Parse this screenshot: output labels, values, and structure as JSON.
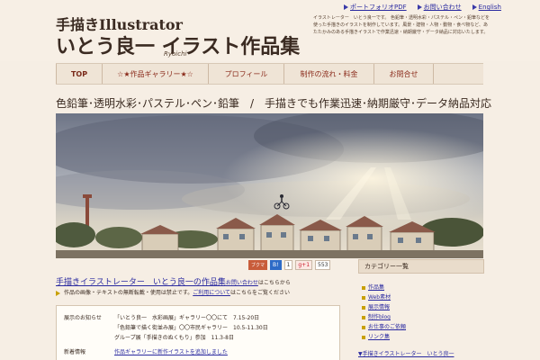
{
  "header": {
    "logo_line1": "手描きIllustrator",
    "logo_line2": "いとう良一 イラスト作品集",
    "logo_sub": "Ryoichi",
    "description": "イラストレーター　いとう良一です。 色鉛筆・透明水彩・パステル・ペン・鉛筆などを使った手描きのイラストを制作しています。風景・建物・人物・動物・食べ物など、あたたかみのある手描きイラストで作業迅速・納期厳守・データ納品に対応いたします。",
    "links": [
      {
        "label": "ポートフォリオPDF"
      },
      {
        "label": "お問い合わせ"
      },
      {
        "label": "English"
      }
    ]
  },
  "nav": {
    "items": [
      {
        "label": "TOP"
      },
      {
        "label": "☆★作品ギャラリー★☆"
      },
      {
        "label": "プロフィール"
      },
      {
        "label": "制作の流れ・料金"
      },
      {
        "label": "お問合せ"
      }
    ]
  },
  "tagline": "色鉛筆･透明水彩･パステル･ペン･鉛筆　/　手描きでも作業迅速･納期厳守･データ納品対応",
  "social": {
    "label": "ブクマ",
    "hatena": "B!",
    "hatena_count": "1",
    "gplus": "g+1",
    "gplus_count": "553"
  },
  "main": {
    "title_link": "手描きイラストレーター　いとう良一の作品集",
    "title_small": "お問い合わせ",
    "title_rest": "はこちらから",
    "note_text": "作品の画像・テキストの無断転載・使用は禁止です。",
    "note_link": "ご利用について",
    "note_rest": "はこちらをご覧ください",
    "info": [
      {
        "label": "展示のお知らせ",
        "lines": [
          "「いとう良一　水彩画展」ギャラリー〇〇にて　7.15-20日",
          "「色鉛筆で描く街並み展」〇〇市民ギャラリー　10.5-11.30日",
          "グループ展「手描きのぬくもり」参加　11.3-8日"
        ]
      },
      {
        "label": "新着情報",
        "lines": [
          "作品ギャラリーに新作イラストを追加しました"
        ]
      }
    ]
  },
  "sidebar": {
    "heading": "カテゴリー一覧",
    "items": [
      {
        "label": "作品集"
      },
      {
        "label": "Web素材"
      },
      {
        "label": "展示情報"
      },
      {
        "label": "制作blog"
      },
      {
        "label": "お仕事のご依頼"
      },
      {
        "label": "リンク集"
      }
    ],
    "more": "▼手描きイラストレーター　いとう良一"
  },
  "colors": {
    "background": "#f6eee4",
    "link": "#2a2aa0",
    "nav_text": "#8a2a1a"
  }
}
